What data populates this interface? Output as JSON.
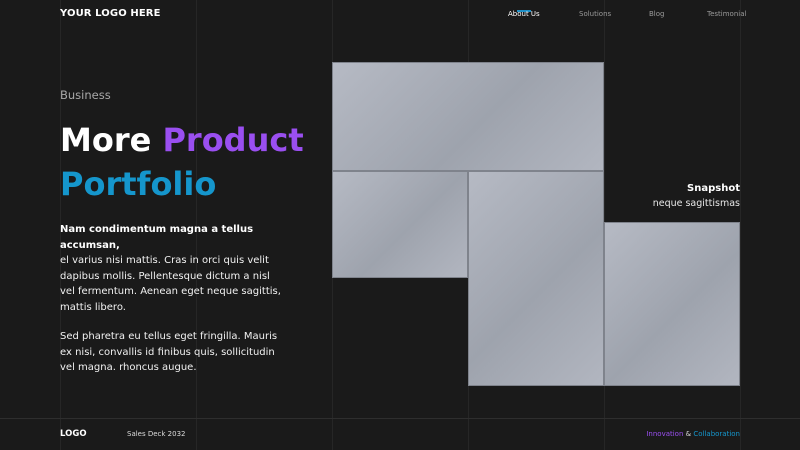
{
  "header": {
    "logo": "YOUR LOGO HERE",
    "nav": [
      {
        "label": "About Us",
        "active": true
      },
      {
        "label": "Solutions",
        "active": false
      },
      {
        "label": "Blog",
        "active": false
      },
      {
        "label": "Testimonial",
        "active": false
      }
    ]
  },
  "hero": {
    "eyebrow": "Business",
    "headline": {
      "word1": "More",
      "word2": "Product",
      "word3": "Portfolio"
    },
    "body_bold": "Nam condimentum magna a tellus accumsan,",
    "body_text": "el varius nisi mattis. Cras in orci quis velit dapibus mollis. Pellentesque dictum a nisl vel fermentum. Aenean eget neque sagittis, mattis libero.",
    "body_text2": "Sed pharetra eu tellus eget fringilla. Mauris ex nisi, convallis id finibus quis, sollicitudin vel magna. rhoncus augue."
  },
  "snapshot": {
    "title": "Snapshot",
    "subtitle": "neque sagittismas"
  },
  "footer": {
    "logo": "LOGO",
    "deck": "Sales Deck 2032",
    "tag1": "Innovation",
    "amp": "&",
    "tag2": "Collaboration"
  },
  "colors": {
    "background": "#1a1a1a",
    "accent_purple": "#9a4ff0",
    "accent_blue": "#1596cc"
  }
}
